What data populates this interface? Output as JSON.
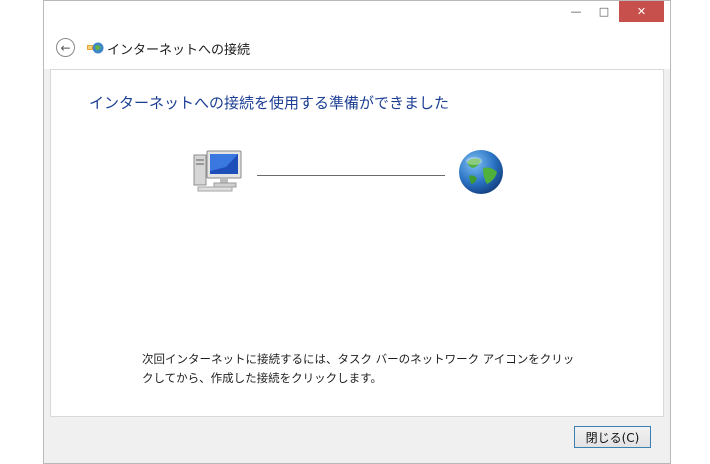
{
  "window": {
    "minimize_glyph": "—",
    "maximize_glyph": "□",
    "close_glyph": "✕"
  },
  "nav": {
    "back_glyph": "←",
    "title": "インターネットへの接続"
  },
  "main": {
    "heading": "インターネットへの接続を使用する準備ができました",
    "hint_line1": "次回インターネットに接続するには、タスク バーのネットワーク アイコンをクリッ",
    "hint_line2": "クしてから、作成した接続をクリックします。",
    "icons": [
      "computer-icon",
      "globe-icon"
    ]
  },
  "footer": {
    "close_label": "閉じる(C)"
  },
  "colors": {
    "heading": "#1c3f94",
    "close_button_accent": "#c7504d",
    "button_border": "#3c7fb1"
  }
}
